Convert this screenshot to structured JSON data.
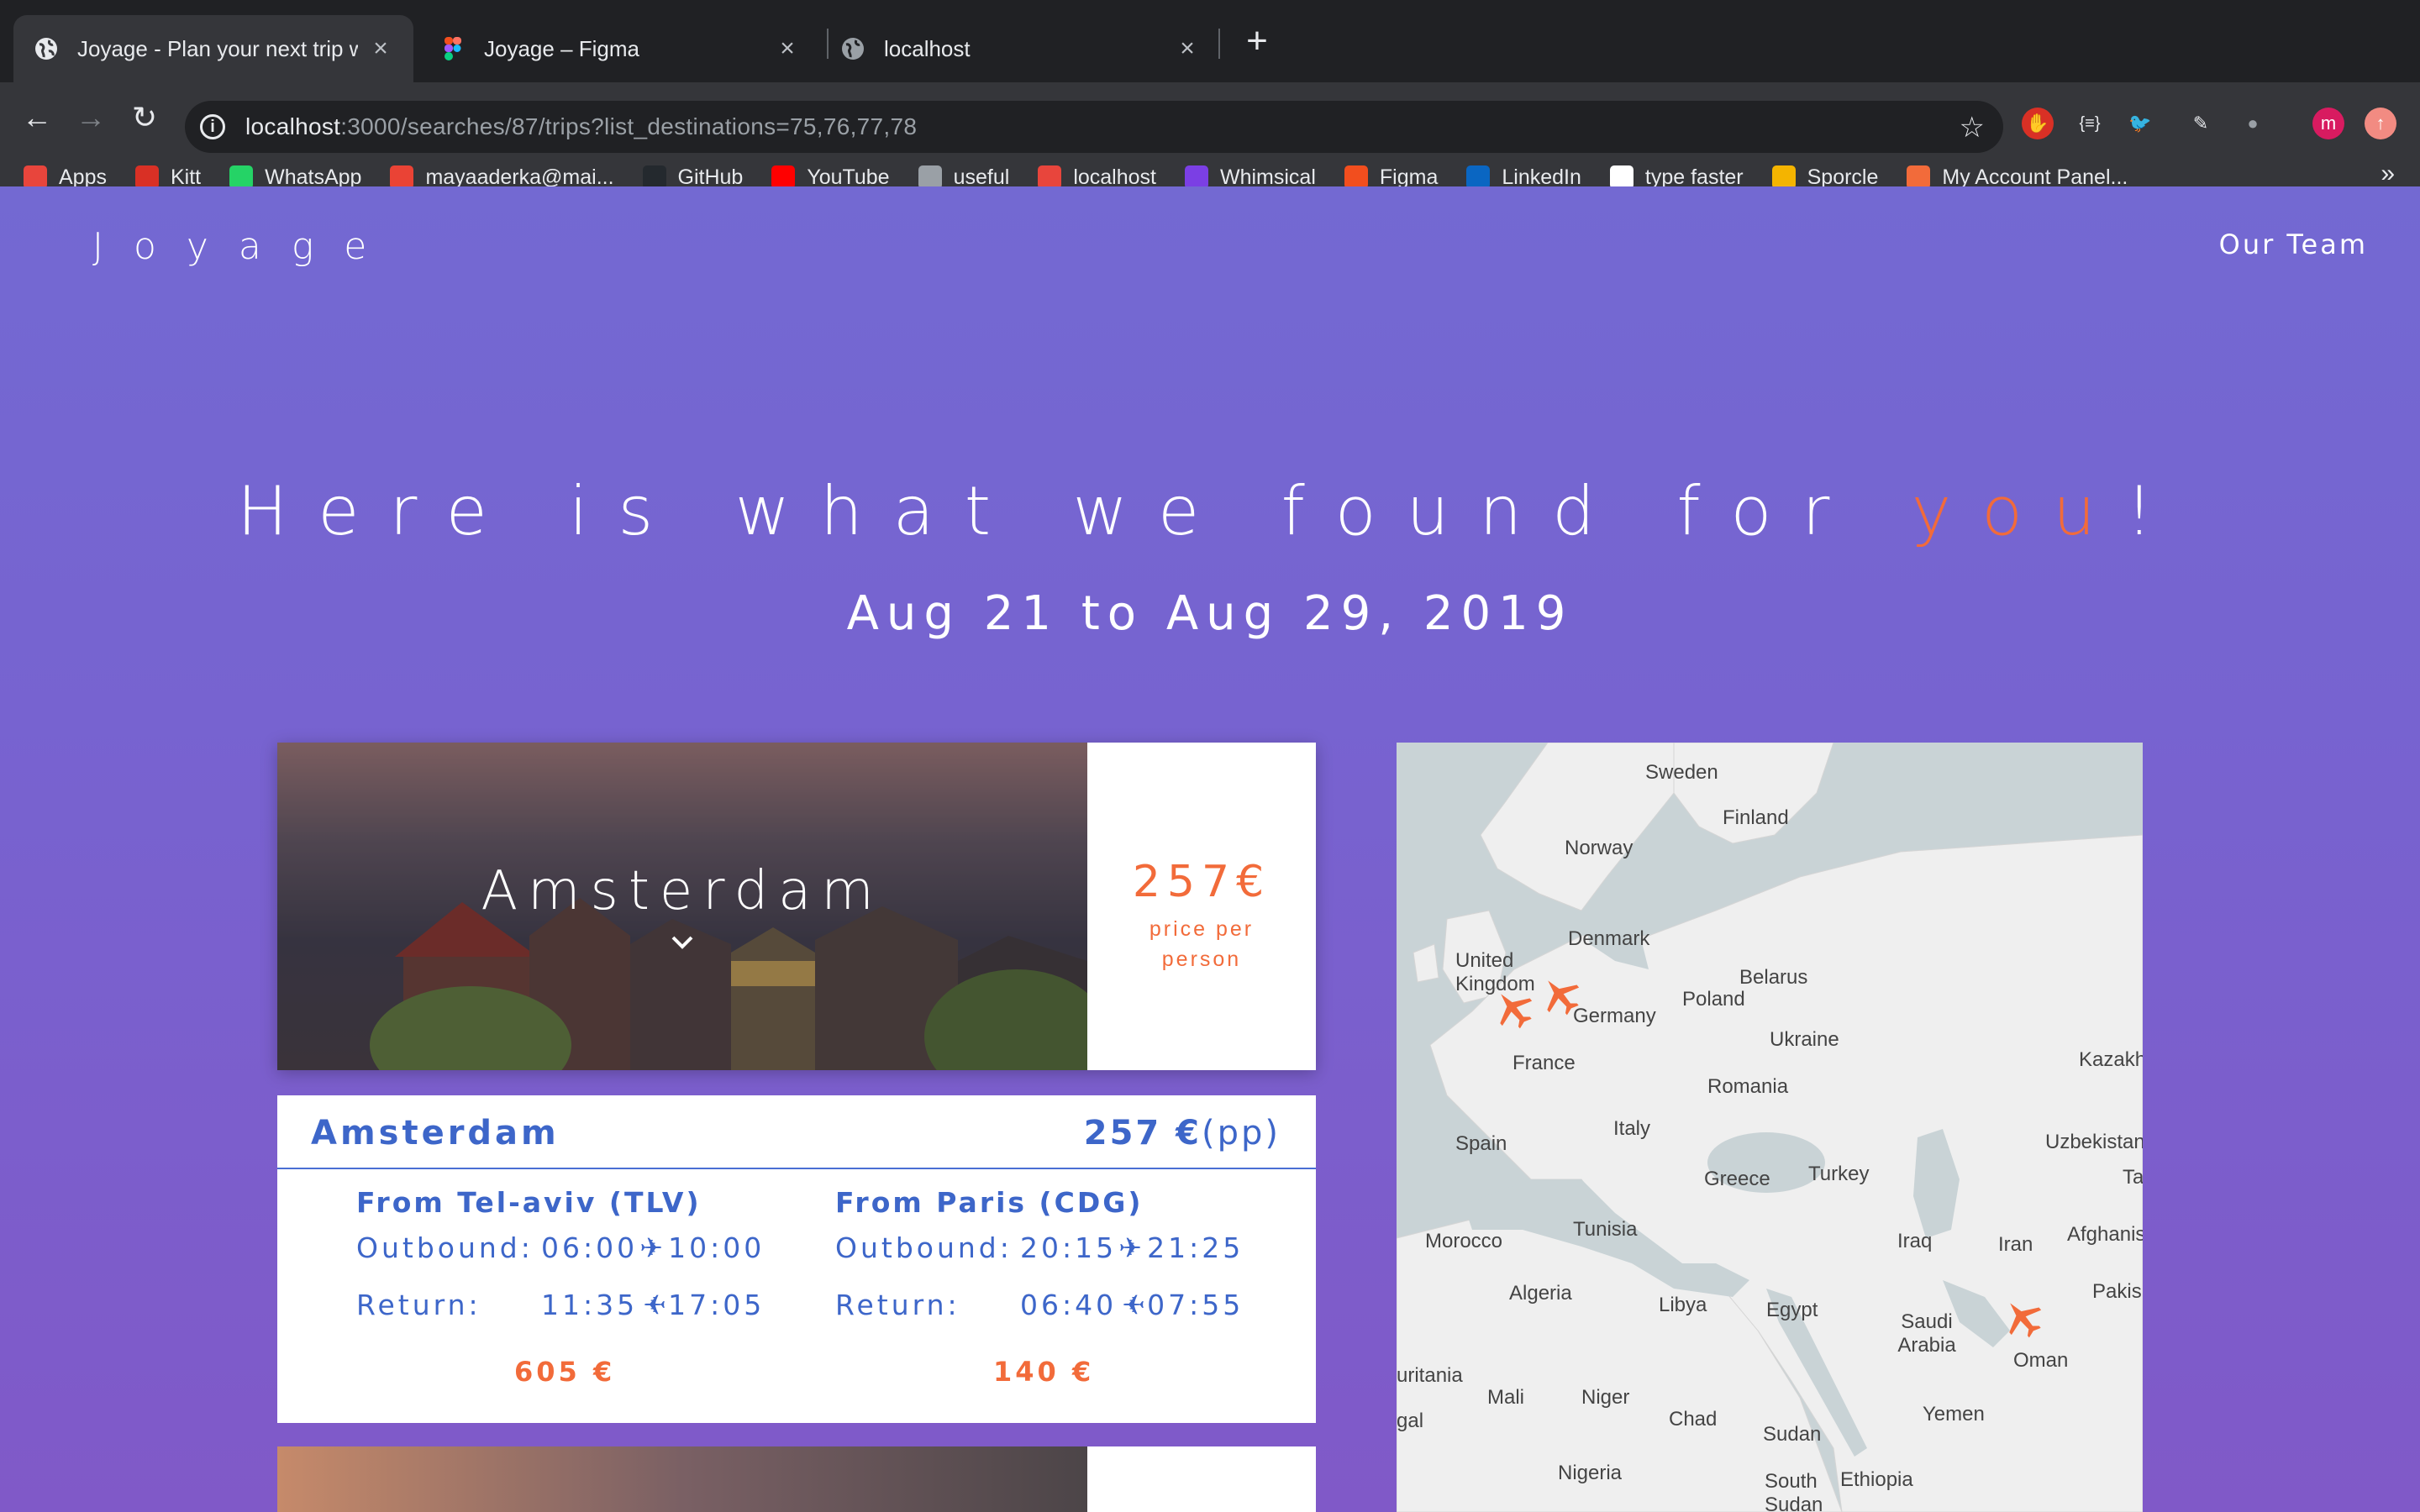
{
  "browser": {
    "tabs": [
      {
        "title": "Joyage - Plan your next trip with",
        "icon": "globe-icon",
        "active": true
      },
      {
        "title": "Joyage – Figma",
        "icon": "figma-icon",
        "active": false
      },
      {
        "title": "localhost",
        "icon": "globe-icon",
        "active": false
      }
    ],
    "url_host": "localhost",
    "url_rest": ":3000/searches/87/trips?list_destinations=75,76,77,78",
    "bookmarks": [
      {
        "label": "Apps",
        "icon": "apps-grid-icon",
        "color": "#e8453c"
      },
      {
        "label": "Kitt",
        "icon": "car-icon",
        "color": "#d93025"
      },
      {
        "label": "WhatsApp",
        "icon": "whatsapp-icon",
        "color": "#25d366"
      },
      {
        "label": "mayaaderka@mai...",
        "icon": "gmail-icon",
        "color": "#ea4335"
      },
      {
        "label": "GitHub",
        "icon": "github-icon",
        "color": "#24292e"
      },
      {
        "label": "YouTube",
        "icon": "youtube-icon",
        "color": "#ff0000"
      },
      {
        "label": "useful",
        "icon": "folder-icon",
        "color": "#9aa0a6"
      },
      {
        "label": "localhost",
        "icon": "localhost-icon",
        "color": "#e8453c"
      },
      {
        "label": "Whimsical",
        "icon": "whimsical-icon",
        "color": "#7b3fe4"
      },
      {
        "label": "Figma",
        "icon": "figma-icon",
        "color": "#f24e1e"
      },
      {
        "label": "LinkedIn",
        "icon": "linkedin-icon",
        "color": "#0a66c2"
      },
      {
        "label": "type faster",
        "icon": "typing-icon",
        "color": "#ffffff"
      },
      {
        "label": "Sporcle",
        "icon": "sporcle-icon",
        "color": "#f4b400"
      },
      {
        "label": "My Account Panel...",
        "icon": "account-panel-icon",
        "color": "#f26b3a"
      }
    ],
    "profile_initial": "m"
  },
  "page": {
    "brand": "Joyage",
    "nav_team": "Our Team",
    "headline_pre": "Here is what we found for ",
    "headline_accent": "you",
    "headline_post": "!",
    "dates": "Aug 21 to Aug 29, 2019",
    "accent_color": "#f26b3a",
    "primary_blue": "#3d66c9"
  },
  "destination": {
    "name": "Amsterdam",
    "price": "257€",
    "price_caption": "price per person"
  },
  "flights": {
    "city": "Amsterdam",
    "total_price": "257 €",
    "total_suffix": "(pp)",
    "legs": [
      {
        "from": "From Tel-aviv (TLV)",
        "outbound_label": "Outbound:",
        "outbound_dep": "06:00",
        "outbound_arr": "10:00",
        "return_label": "Return:",
        "return_dep": "11:35",
        "return_arr": "17:05",
        "cost": "605 €"
      },
      {
        "from": "From Paris (CDG)",
        "outbound_label": "Outbound:",
        "outbound_dep": "20:15",
        "outbound_arr": "21:25",
        "return_label": "Return:",
        "return_dep": "06:40",
        "return_arr": "07:55",
        "cost": "140 €"
      }
    ]
  },
  "map": {
    "labels": [
      "Sweden",
      "Finland",
      "Norway",
      "Denmark",
      "United Kingdom",
      "Belarus",
      "Poland",
      "Germany",
      "Ukraine",
      "France",
      "Kazakh",
      "Romania",
      "Italy",
      "Spain",
      "Uzbekistan",
      "Turkey",
      "Greece",
      "Ta",
      "Morocco",
      "Tunisia",
      "Iraq",
      "Iran",
      "Afghanis",
      "Algeria",
      "Libya",
      "Egypt",
      "Pakis",
      "Saudi Arabia",
      "Oman",
      "uritania",
      "Mali",
      "Niger",
      "Yemen",
      "gal",
      "Chad",
      "Sudan",
      "Nigeria",
      "South Sudan",
      "Ethiopia"
    ],
    "marker_icon": "plane-marker-icon"
  }
}
